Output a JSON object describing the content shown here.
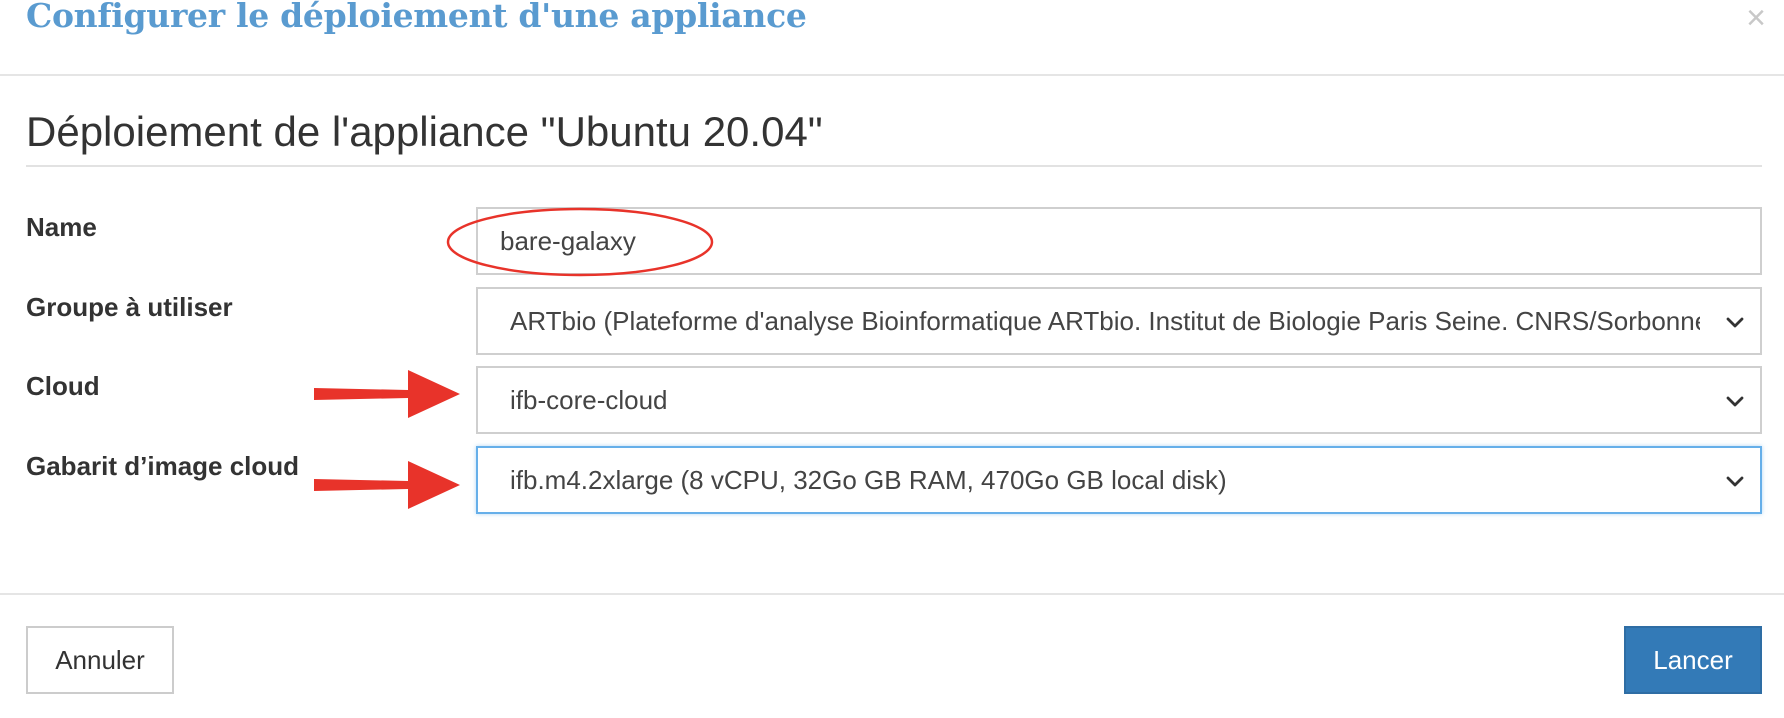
{
  "modal": {
    "title": "Configurer le déploiement d'une appliance",
    "close_symbol": "×"
  },
  "form": {
    "heading": "Déploiement de l'appliance \"Ubuntu 20.04\"",
    "fields": {
      "name": {
        "label": "Name",
        "value": "bare-galaxy"
      },
      "group": {
        "label": "Groupe à utiliser",
        "value": "ARTbio (Plateforme d'analyse Bioinformatique ARTbio. Institut de Biologie Paris Seine. CNRS/Sorbonne Université)"
      },
      "cloud": {
        "label": "Cloud",
        "value": "ifb-core-cloud"
      },
      "flavor": {
        "label": "Gabarit d’image cloud",
        "value": "ifb.m4.2xlarge (8 vCPU, 32Go GB RAM, 470Go GB local disk)"
      }
    }
  },
  "footer": {
    "cancel_label": "Annuler",
    "launch_label": "Lancer"
  },
  "icons": {
    "close": "close-icon",
    "dropdown": "chevron-down-icon",
    "annotation_arrow": "red-arrow",
    "annotation_circle": "red-ellipse"
  },
  "colors": {
    "title": "#5a9bd0",
    "primary_button": "#337ab7",
    "focus_border": "#66afe9",
    "annotation": "#e8332a"
  }
}
